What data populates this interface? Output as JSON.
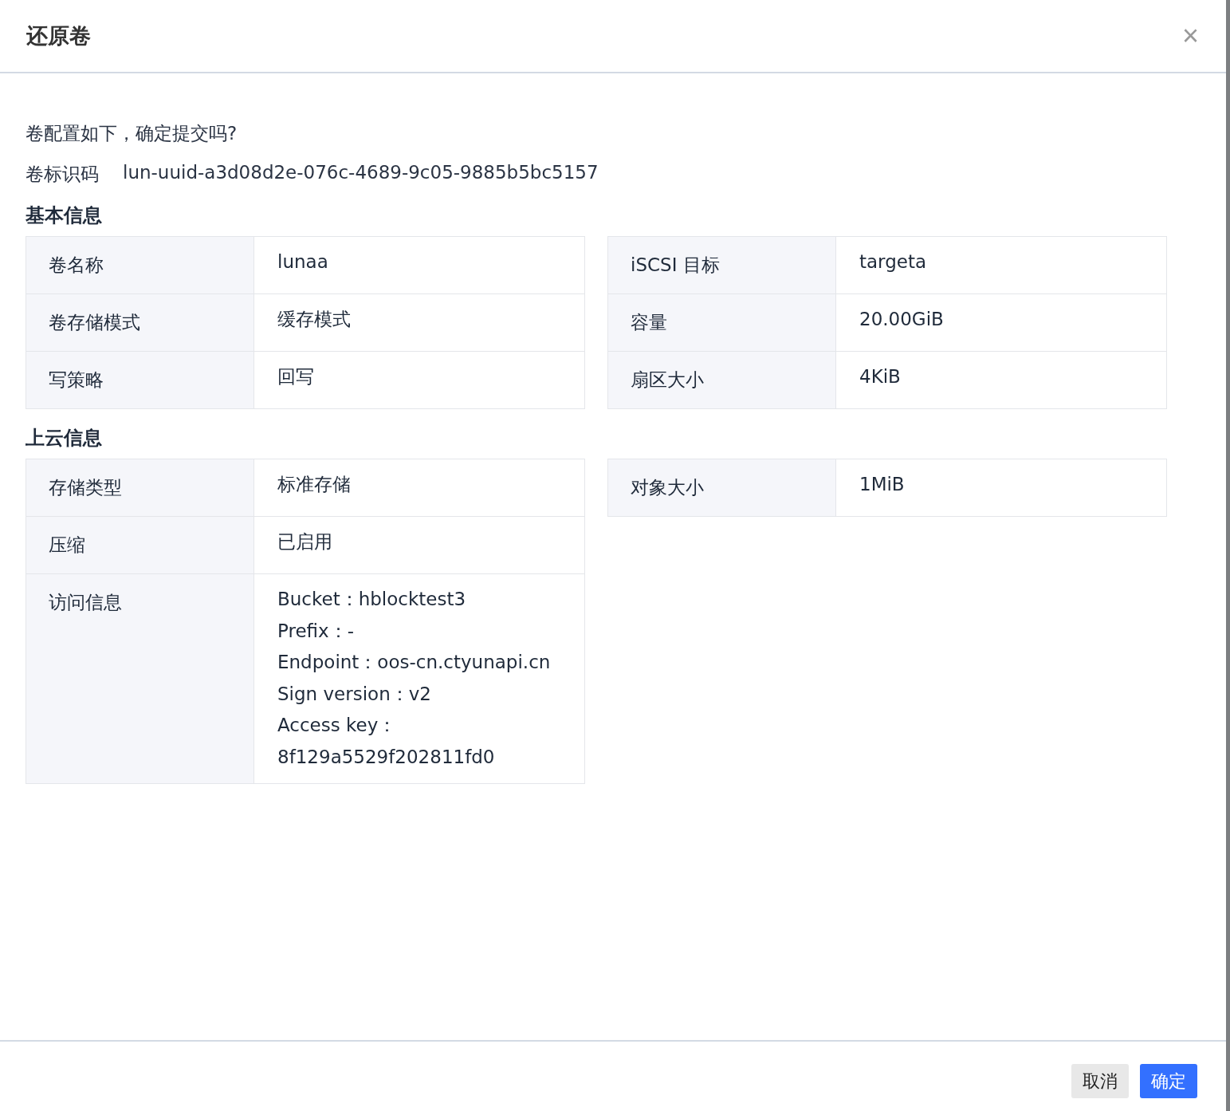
{
  "dialog": {
    "title": "还原卷",
    "close_icon": "×"
  },
  "prompt": "卷配置如下，确定提交吗?",
  "volume_id": {
    "label": "卷标识码",
    "value": "lun-uuid-a3d08d2e-076c-4689-9c05-9885b5bc5157"
  },
  "sections": [
    {
      "title": "基本信息",
      "left": [
        {
          "label": "卷名称",
          "value": [
            "lunaa"
          ]
        },
        {
          "label": "卷存储模式",
          "value": [
            "缓存模式"
          ]
        },
        {
          "label": "写策略",
          "value": [
            "回写"
          ]
        }
      ],
      "right": [
        {
          "label": "iSCSI 目标",
          "value": [
            "targeta"
          ]
        },
        {
          "label": "容量",
          "value": [
            "20.00GiB"
          ]
        },
        {
          "label": "扇区大小",
          "value": [
            "4KiB"
          ]
        }
      ]
    },
    {
      "title": "上云信息",
      "left": [
        {
          "label": "存储类型",
          "value": [
            "标准存储"
          ]
        },
        {
          "label": "压缩",
          "value": [
            "已启用"
          ]
        },
        {
          "label": "访问信息",
          "value": [
            "Bucket：hblocktest3",
            "Prefix：-",
            "Endpoint：oos-cn.ctyunapi.cn",
            "Sign version：v2",
            "Access key：8f129a5529f202811fd0"
          ]
        }
      ],
      "right": [
        {
          "label": "对象大小",
          "value": [
            "1MiB"
          ]
        }
      ]
    }
  ],
  "buttons": [
    {
      "label": "取消",
      "kind": "secondary"
    },
    {
      "label": "确定",
      "kind": "primary"
    }
  ]
}
